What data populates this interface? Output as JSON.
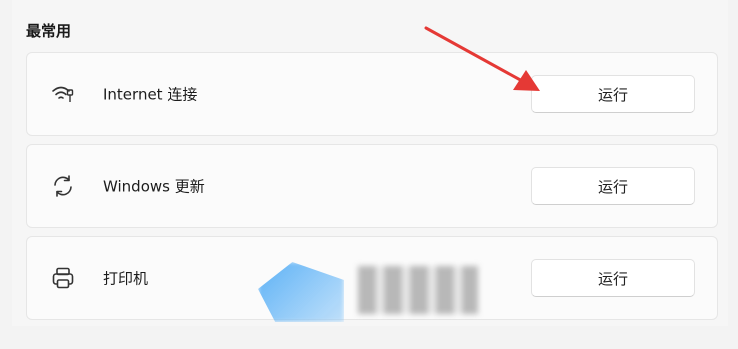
{
  "section": {
    "title": "最常用"
  },
  "items": [
    {
      "label": "Internet 连接",
      "button": "运行",
      "icon": "wifi-icon"
    },
    {
      "label": "Windows 更新",
      "button": "运行",
      "icon": "refresh-icon"
    },
    {
      "label": "打印机",
      "button": "运行",
      "icon": "printer-icon"
    }
  ],
  "colors": {
    "background": "#f3f3f3",
    "card": "#fbfbfb",
    "button": "#ffffff",
    "arrow": "#e53935"
  }
}
